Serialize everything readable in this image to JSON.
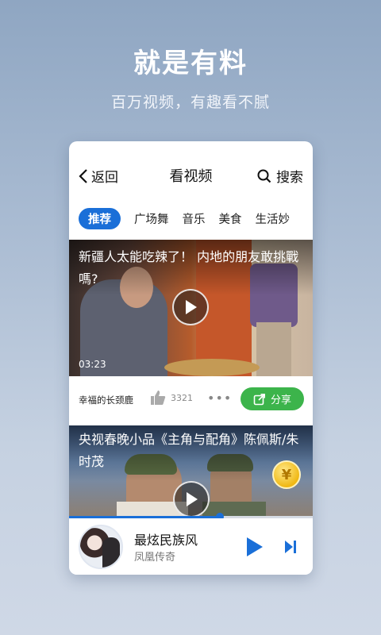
{
  "hero": {
    "title": "就是有料",
    "subtitle": "百万视频，有趣看不腻"
  },
  "topbar": {
    "back_label": "返回",
    "title": "看视频",
    "search_label": "搜索"
  },
  "tabs": [
    {
      "label": "推荐",
      "active": true
    },
    {
      "label": "广场舞",
      "active": false
    },
    {
      "label": "音乐",
      "active": false
    },
    {
      "label": "美食",
      "active": false
    },
    {
      "label": "生活妙",
      "active": false
    }
  ],
  "videos": [
    {
      "title": "新疆人太能吃辣了！ 内地的朋友敢挑戰嗎?",
      "duration": "03:23",
      "author": "幸福的长颈鹿",
      "likes": "3321",
      "share_label": "分享"
    },
    {
      "title": "央视春晚小品《主角与配角》陈佩斯/朱时茂",
      "coin_symbol": "¥"
    }
  ],
  "player": {
    "song": "最炫民族风",
    "artist": "凤凰传奇",
    "progress_fraction": 0.62
  },
  "colors": {
    "accent": "#1a6fd8",
    "share_green": "#3cb44b"
  }
}
